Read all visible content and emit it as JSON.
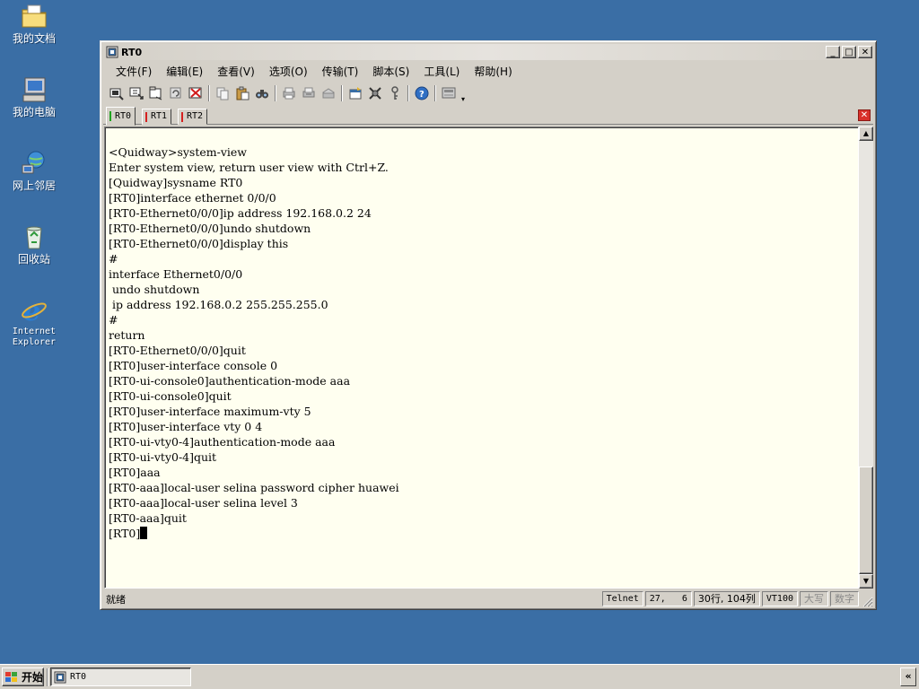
{
  "desktop": {
    "icons": [
      {
        "label": "我的文档",
        "icon": "my-documents-icon"
      },
      {
        "label": "我的电脑",
        "icon": "my-computer-icon"
      },
      {
        "label": "网上邻居",
        "icon": "network-places-icon"
      },
      {
        "label": "回收站",
        "icon": "recycle-bin-icon"
      },
      {
        "label": "Internet\nExplorer",
        "icon": "internet-explorer-icon"
      }
    ]
  },
  "window": {
    "title": "RT0",
    "min_glyph": "_",
    "max_glyph": "□",
    "close_glyph": "✕"
  },
  "menu": [
    "文件(F)",
    "编辑(E)",
    "查看(V)",
    "选项(O)",
    "传输(T)",
    "脚本(S)",
    "工具(L)",
    "帮助(H)"
  ],
  "toolbar": {
    "icons": [
      "connect-icon",
      "quick-connect-icon",
      "connect-in-tab-icon",
      "reconnect-icon",
      "disconnect-icon",
      "copy-icon",
      "paste-icon",
      "find-icon",
      "print-icon",
      "print-setup-icon",
      "print-selection-icon",
      "session-options-icon",
      "global-options-icon",
      "keymap-icon",
      "help-icon",
      "sftp-icon"
    ],
    "dropdown_glyph": "▾"
  },
  "tabs": [
    {
      "label": "RT0",
      "marker_color": "#1fa31f",
      "active": true
    },
    {
      "label": "RT1",
      "marker_color": "#d62020",
      "active": false
    },
    {
      "label": "RT2",
      "marker_color": "#d62020",
      "active": false
    }
  ],
  "tab_close_glyph": "✕",
  "terminal": {
    "lines": [
      "<Quidway>system-view",
      "Enter system view, return user view with Ctrl+Z.",
      "[Quidway]sysname RT0",
      "[RT0]interface ethernet 0/0/0",
      "[RT0-Ethernet0/0/0]ip address 192.168.0.2 24",
      "[RT0-Ethernet0/0/0]undo shutdown",
      "[RT0-Ethernet0/0/0]display this",
      "#",
      "interface Ethernet0/0/0",
      " undo shutdown",
      " ip address 192.168.0.2 255.255.255.0",
      "#",
      "return",
      "[RT0-Ethernet0/0/0]quit",
      "[RT0]user-interface console 0",
      "[RT0-ui-console0]authentication-mode aaa",
      "[RT0-ui-console0]quit",
      "[RT0]user-interface maximum-vty 5",
      "[RT0]user-interface vty 0 4",
      "[RT0-ui-vty0-4]authentication-mode aaa",
      "[RT0-ui-vty0-4]quit",
      "[RT0]aaa",
      "[RT0-aaa]local-user selina password cipher huawei",
      "[RT0-aaa]local-user selina level 3",
      "[RT0-aaa]quit"
    ],
    "prompt": "[RT0]",
    "scroll_position": 1.0
  },
  "statusbar": {
    "ready": "就绪",
    "protocol": "Telnet",
    "cursor_pos": "27,   6",
    "size": "30行, 104列",
    "emulation": "VT100",
    "caps": "大写",
    "num": "数字"
  },
  "taskbar": {
    "start_label": "开始",
    "task_label": "RT0",
    "tray_glyph": "«"
  }
}
